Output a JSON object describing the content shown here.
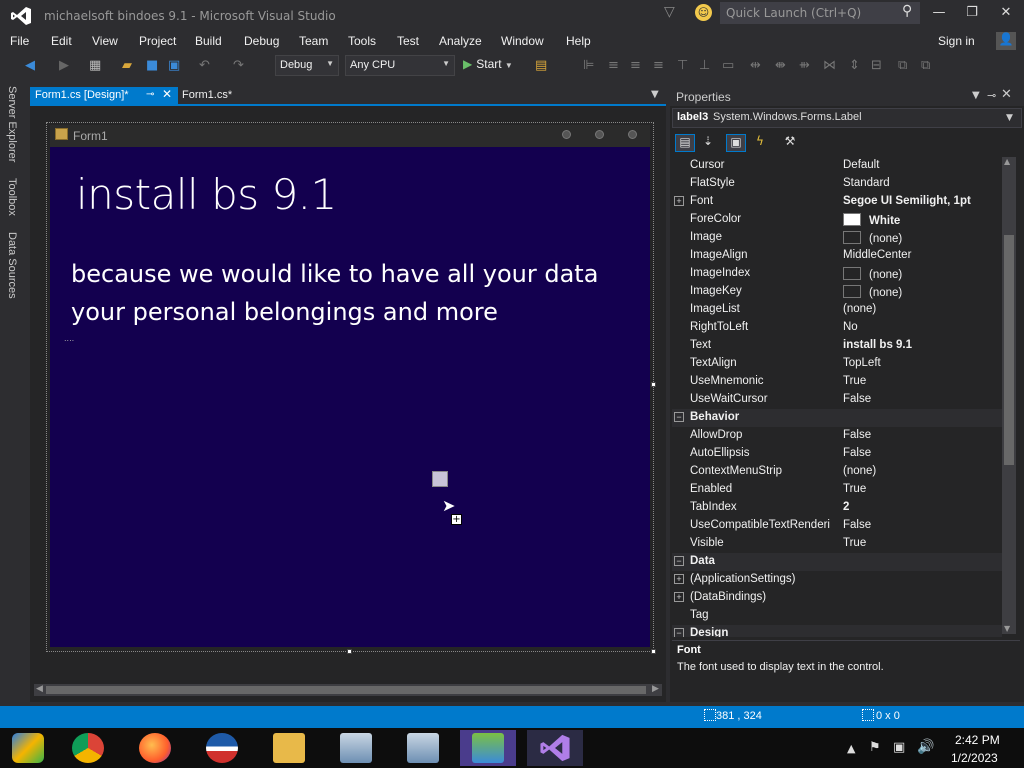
{
  "window": {
    "title": "michaelsoft bindoes 9.1 - Microsoft Visual Studio",
    "quick_launch_placeholder": "Quick Launch (Ctrl+Q)",
    "controls": [
      "minimize-icon",
      "maximize-icon",
      "close-icon"
    ]
  },
  "menu": {
    "items": [
      "File",
      "Edit",
      "View",
      "Project",
      "Build",
      "Debug",
      "Team",
      "Tools",
      "Test",
      "Analyze",
      "Window",
      "Help"
    ],
    "sign_in": "Sign in"
  },
  "toolbar": {
    "configuration": "Debug",
    "platform": "Any CPU",
    "start_label": "Start"
  },
  "side_tabs": [
    "Server Explorer",
    "Toolbox",
    "Data Sources"
  ],
  "doc_tabs": [
    {
      "label": "Form1.cs [Design]*",
      "active": true
    },
    {
      "label": "Form1.cs*",
      "active": false
    }
  ],
  "designer": {
    "form_title": "Form1",
    "form_back_color": "#13004f",
    "label_title": "install bs 9.1",
    "label_body_line1": "because we would like to have all your data",
    "label_body_line2": "your personal belongings and more",
    "label_small": "...."
  },
  "properties": {
    "title": "Properties",
    "object_name": "label3",
    "object_type": "System.Windows.Forms.Label",
    "rows": [
      {
        "name": "Cursor",
        "value": "Default",
        "bold": false,
        "kind": "prop"
      },
      {
        "name": "FlatStyle",
        "value": "Standard",
        "bold": false,
        "kind": "prop"
      },
      {
        "name": "Font",
        "value": "Segoe UI Semilight, 1pt",
        "bold": true,
        "kind": "prop",
        "expandable": true
      },
      {
        "name": "ForeColor",
        "value": "White",
        "bold": true,
        "kind": "prop",
        "swatch": "#ffffff"
      },
      {
        "name": "Image",
        "value": "(none)",
        "bold": false,
        "kind": "prop",
        "swatch": "#252526"
      },
      {
        "name": "ImageAlign",
        "value": "MiddleCenter",
        "bold": false,
        "kind": "prop"
      },
      {
        "name": "ImageIndex",
        "value": "(none)",
        "bold": false,
        "kind": "prop",
        "swatch": "#252526"
      },
      {
        "name": "ImageKey",
        "value": "(none)",
        "bold": false,
        "kind": "prop",
        "swatch": "#252526"
      },
      {
        "name": "ImageList",
        "value": "(none)",
        "bold": false,
        "kind": "prop"
      },
      {
        "name": "RightToLeft",
        "value": "No",
        "bold": false,
        "kind": "prop"
      },
      {
        "name": "Text",
        "value": "install bs 9.1",
        "bold": true,
        "kind": "prop"
      },
      {
        "name": "TextAlign",
        "value": "TopLeft",
        "bold": false,
        "kind": "prop"
      },
      {
        "name": "UseMnemonic",
        "value": "True",
        "bold": false,
        "kind": "prop"
      },
      {
        "name": "UseWaitCursor",
        "value": "False",
        "bold": false,
        "kind": "prop"
      },
      {
        "name": "Behavior",
        "value": "",
        "bold": true,
        "kind": "cat"
      },
      {
        "name": "AllowDrop",
        "value": "False",
        "bold": false,
        "kind": "prop"
      },
      {
        "name": "AutoEllipsis",
        "value": "False",
        "bold": false,
        "kind": "prop"
      },
      {
        "name": "ContextMenuStrip",
        "value": "(none)",
        "bold": false,
        "kind": "prop"
      },
      {
        "name": "Enabled",
        "value": "True",
        "bold": false,
        "kind": "prop"
      },
      {
        "name": "TabIndex",
        "value": "2",
        "bold": true,
        "kind": "prop"
      },
      {
        "name": "UseCompatibleTextRenderi",
        "value": "False",
        "bold": false,
        "kind": "prop"
      },
      {
        "name": "Visible",
        "value": "True",
        "bold": false,
        "kind": "prop"
      },
      {
        "name": "Data",
        "value": "",
        "bold": true,
        "kind": "cat"
      },
      {
        "name": "(ApplicationSettings)",
        "value": "",
        "bold": false,
        "kind": "prop",
        "expandable": true
      },
      {
        "name": "(DataBindings)",
        "value": "",
        "bold": false,
        "kind": "prop",
        "expandable": true
      },
      {
        "name": "Tag",
        "value": "",
        "bold": false,
        "kind": "prop"
      },
      {
        "name": "Design",
        "value": "",
        "bold": true,
        "kind": "cat"
      }
    ],
    "description_title": "Font",
    "description_text": "The font used to display text in the control."
  },
  "statusbar": {
    "position": "381 , 324",
    "size": "0 x 0"
  },
  "taskbar": {
    "apps": [
      "windows-media-icon",
      "chrome-icon",
      "firefox-icon",
      "obama-logo-icon",
      "file-explorer-icon",
      "setup-installer-icon",
      "setup-installer-icon-2",
      "people-app-icon",
      "visual-studio-icon"
    ],
    "time": "2:42 PM",
    "date": "1/2/2023"
  }
}
